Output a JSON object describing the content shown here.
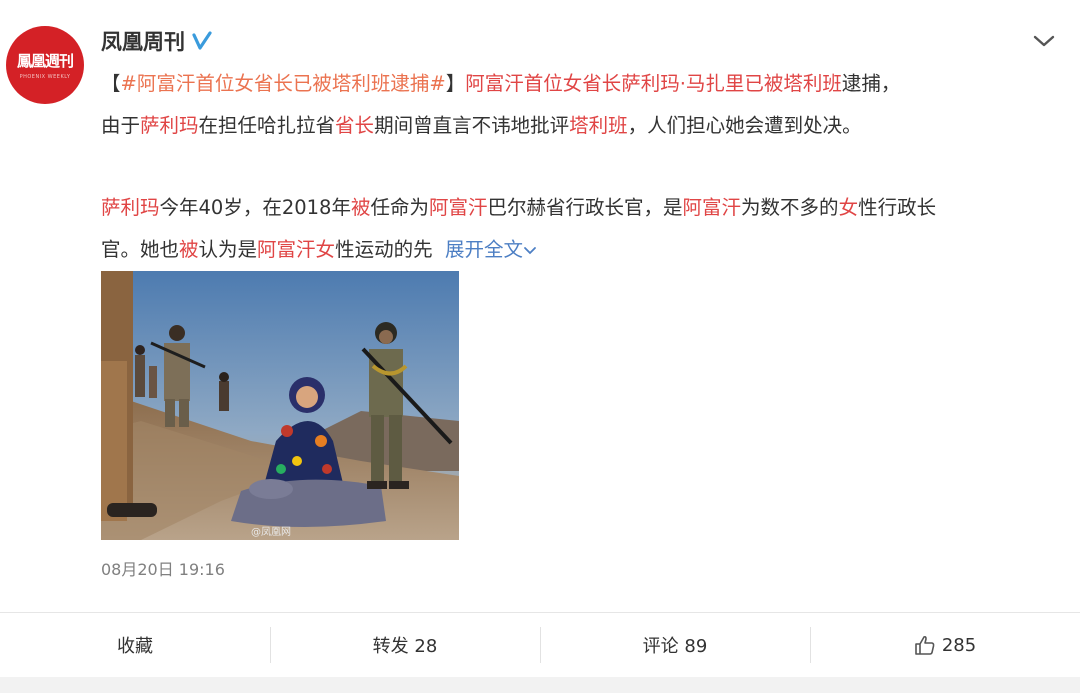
{
  "author": {
    "name": "凤凰周刊",
    "avatar_text": "鳳凰週刊",
    "avatar_subtext": "PHOENIX WEEKLY"
  },
  "post": {
    "hashtag": "#阿富汗首位女省长已被塔利班逮捕#",
    "line1": {
      "bracket_open": "【",
      "bracket_close": "】",
      "hl1": "阿富汗首位女省长萨利玛·马扎里已被塔利班",
      "t1": "逮捕，"
    },
    "line2": {
      "t1": "由于",
      "hl1": "萨利玛",
      "t2": "在担任哈扎拉省",
      "hl2": "省长",
      "t3": "期间曾直言不讳地批评",
      "hl3": "塔利班",
      "t4": "，人们担心她会遭到处决。"
    },
    "line3": {
      "hl1": "萨利玛",
      "t1": "今年40岁，在2018年",
      "hl2": "被",
      "t2": "任命为",
      "hl3": "阿富汗",
      "t3": "巴尔赫省行政长官，是",
      "hl4": "阿富汗",
      "t4": "为数不多的",
      "hl5": "女",
      "t5": "性行政长"
    },
    "line4": {
      "t1": "官。她也",
      "hl1": "被",
      "t2": "认为是",
      "hl2": "阿富汗女",
      "t3": "性运动的先",
      "expand": "展开全文"
    },
    "image_watermark": "@凤凰网",
    "timestamp": "08月20日 19:16"
  },
  "actions": {
    "favorite": "收藏",
    "repost": "转发 28",
    "comment": "评论 89",
    "like": "285"
  },
  "colors": {
    "highlight": "#e04545",
    "link": "#eb7350",
    "expand": "#4d7fc4",
    "avatar_bg": "#d42126",
    "verified": "#3a9bdc"
  }
}
